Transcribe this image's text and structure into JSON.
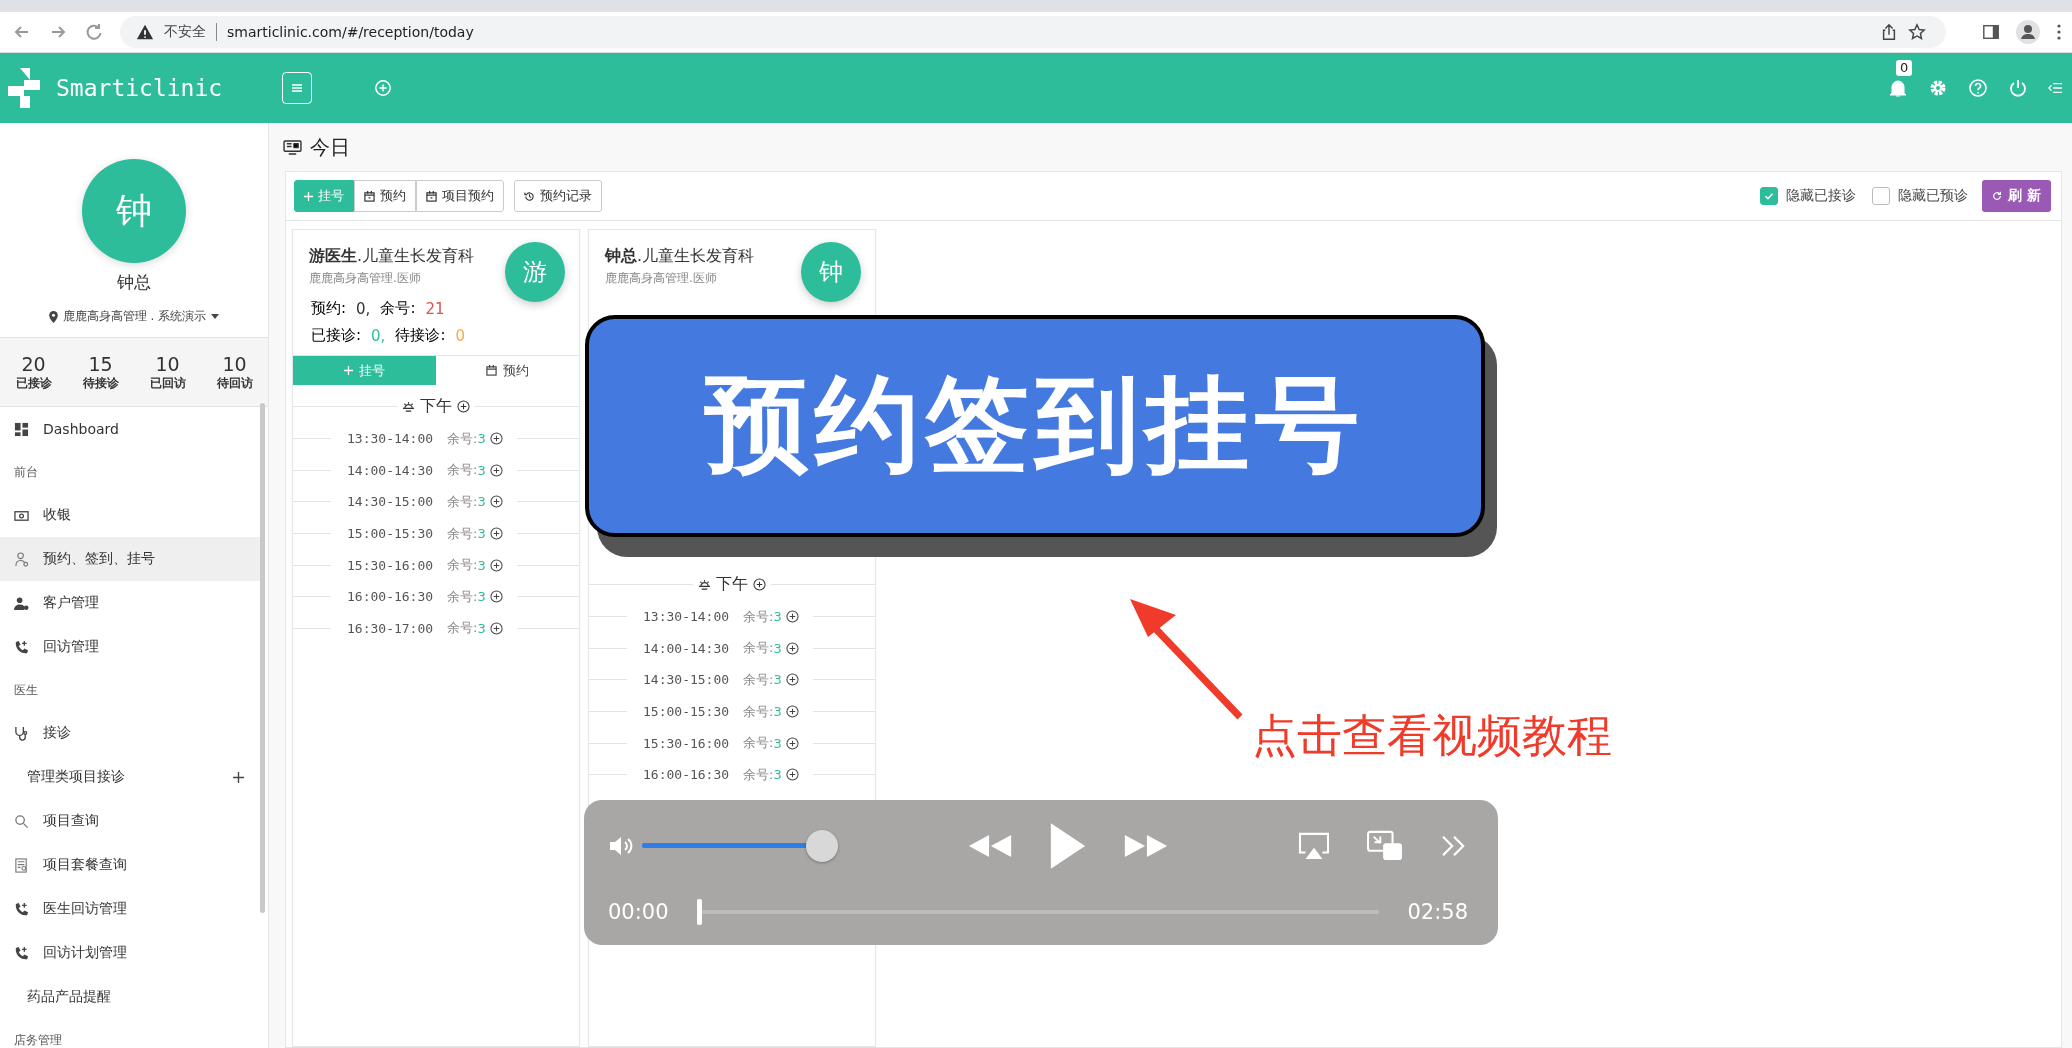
{
  "browser": {
    "security_label": "不安全",
    "url": "smarticlinic.com/#/reception/today"
  },
  "header": {
    "app_name": "Smarticlinic",
    "notification_count": "0"
  },
  "sidebar": {
    "avatar_text": "钟",
    "user_name": "钟总",
    "location": "鹿鹿高身高管理 . 系统演示",
    "stats": [
      {
        "value": "20",
        "label": "已接诊"
      },
      {
        "value": "15",
        "label": "待接诊"
      },
      {
        "value": "10",
        "label": "已回访"
      },
      {
        "value": "10",
        "label": "待回访"
      }
    ],
    "menu": [
      {
        "kind": "item",
        "label": "Dashboard",
        "selected": false
      },
      {
        "kind": "section",
        "label": "前台"
      },
      {
        "kind": "item",
        "label": "收银",
        "selected": false
      },
      {
        "kind": "item",
        "label": "预约、签到、挂号",
        "selected": true
      },
      {
        "kind": "item",
        "label": "客户管理",
        "selected": false
      },
      {
        "kind": "item",
        "label": "回访管理",
        "selected": false
      },
      {
        "kind": "section",
        "label": "医生"
      },
      {
        "kind": "item",
        "label": "接诊",
        "selected": false
      },
      {
        "kind": "group",
        "label": "管理类项目接诊",
        "selected": false
      },
      {
        "kind": "item",
        "label": "项目查询",
        "selected": false
      },
      {
        "kind": "item",
        "label": "项目套餐查询",
        "selected": false
      },
      {
        "kind": "item",
        "label": "医生回访管理",
        "selected": false
      },
      {
        "kind": "item",
        "label": "回访计划管理",
        "selected": false
      },
      {
        "kind": "sub",
        "label": "药品产品提醒",
        "selected": false
      },
      {
        "kind": "section",
        "label": "店务管理"
      }
    ]
  },
  "page": {
    "title": "今日",
    "toolbar": [
      {
        "label": "挂号",
        "kind": "primary"
      },
      {
        "label": "预约",
        "kind": "plain"
      },
      {
        "label": "项目预约",
        "kind": "plain"
      }
    ],
    "history_button": "预约记录",
    "filters": [
      {
        "label": "隐藏已接诊",
        "checked": true
      },
      {
        "label": "隐藏已预诊",
        "checked": false
      }
    ],
    "refresh_button": "刷 新",
    "cards": [
      {
        "doctor": "游医生",
        "dept": ".儿童生长发育科",
        "org": "鹿鹿高身高管理.医师",
        "avatar": "游",
        "stats": [
          [
            {
              "label": "预约:",
              "value": "0,",
              "color": "#333333"
            },
            {
              "label": "余号:",
              "value": "21",
              "color": "#d9534f"
            }
          ],
          [
            {
              "label": "已接诊:",
              "value": "0,",
              "color": "#2dbd9b"
            },
            {
              "label": "待接诊:",
              "value": "0",
              "color": "#f0ad4e"
            }
          ]
        ],
        "actions": [
          {
            "label": "挂号",
            "kind": "primary"
          },
          {
            "label": "预约",
            "kind": "plain"
          }
        ],
        "session": "下午",
        "slots": [
          {
            "time": "13:30-14:00",
            "remain_label": "余号:",
            "remain": "3"
          },
          {
            "time": "14:00-14:30",
            "remain_label": "余号:",
            "remain": "3"
          },
          {
            "time": "14:30-15:00",
            "remain_label": "余号:",
            "remain": "3"
          },
          {
            "time": "15:00-15:30",
            "remain_label": "余号:",
            "remain": "3"
          },
          {
            "time": "15:30-16:00",
            "remain_label": "余号:",
            "remain": "3"
          },
          {
            "time": "16:00-16:30",
            "remain_label": "余号:",
            "remain": "3"
          },
          {
            "time": "16:30-17:00",
            "remain_label": "余号:",
            "remain": "3"
          }
        ]
      },
      {
        "doctor": "钟总",
        "dept": ".儿童生长发育科",
        "org": "鹿鹿高身高管理.医师",
        "avatar": "钟",
        "session": "下午",
        "slots": [
          {
            "time": "13:30-14:00",
            "remain_label": "余号:",
            "remain": "3"
          },
          {
            "time": "14:00-14:30",
            "remain_label": "余号:",
            "remain": "3"
          },
          {
            "time": "14:30-15:00",
            "remain_label": "余号:",
            "remain": "3"
          },
          {
            "time": "15:00-15:30",
            "remain_label": "余号:",
            "remain": "3"
          },
          {
            "time": "15:30-16:00",
            "remain_label": "余号:",
            "remain": "3"
          },
          {
            "time": "16:00-16:30",
            "remain_label": "余号:",
            "remain": "3"
          }
        ]
      }
    ]
  },
  "banner": {
    "text": "预约签到挂号"
  },
  "callout": "点击查看视频教程",
  "player": {
    "volume": {
      "level": 1
    },
    "progress": {
      "level": 0
    },
    "elapsed": "00:00",
    "duration": "02:58"
  }
}
